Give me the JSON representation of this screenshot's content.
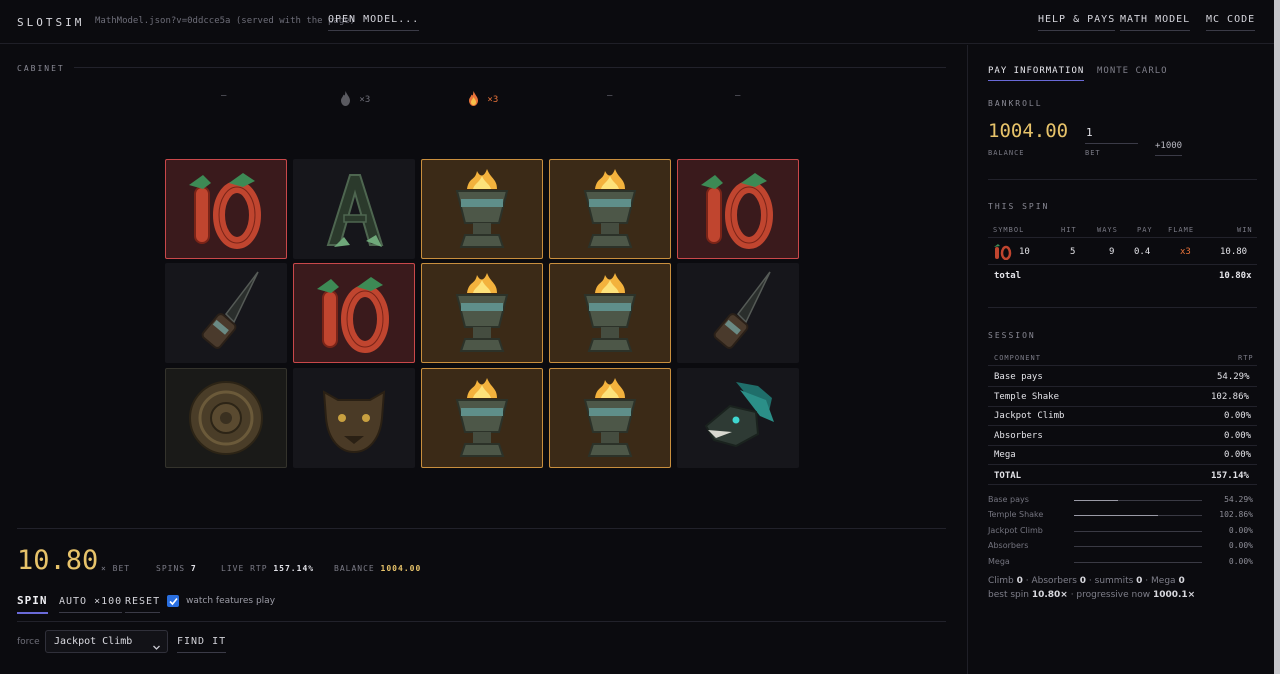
{
  "header": {
    "brand": "SLOTSIM",
    "model_path": "MathModel.json?v=0ddcce5a (served with the page)",
    "open_model": "OPEN MODEL...",
    "help_pays": "HELP & PAYS",
    "math_model": "MATH MODEL",
    "mc_code": "MC CODE"
  },
  "cabinet": {
    "label": "CABINET",
    "flames": [
      "–",
      "×3",
      "×3",
      "–",
      "–"
    ],
    "grid": [
      [
        "ten",
        "ace",
        "brazier",
        "brazier",
        "ten"
      ],
      [
        "dagger",
        "ten",
        "brazier",
        "brazier",
        "dagger"
      ],
      [
        "calendar",
        "jaguar",
        "brazier",
        "brazier",
        "serpent"
      ]
    ]
  },
  "result": {
    "win": "10.80",
    "win_unit": "× BET",
    "spins_label": "SPINS",
    "spins": "7",
    "rtp_label": "LIVE RTP",
    "rtp": "157.14%",
    "balance_label": "BALANCE",
    "balance": "1004.00"
  },
  "controls": {
    "spin": "SPIN",
    "auto": "AUTO ×100",
    "reset": "RESET",
    "watch_label": "watch features play",
    "watch_checked": true,
    "force_label": "force",
    "force_value": "Jackpot Climb",
    "find_it": "FIND IT"
  },
  "panel": {
    "tab_pay": "PAY INFORMATION",
    "tab_mc": "MONTE CARLO",
    "bankroll_label": "BANKROLL",
    "balance_value": "1004.00",
    "balance_caption": "BALANCE",
    "bet_value": "1",
    "bet_caption": "BET",
    "add_1000": "+1000",
    "this_spin_label": "THIS SPIN",
    "spin_headers": [
      "SYMBOL",
      "HIT",
      "WAYS",
      "PAY",
      "FLAME",
      "WIN"
    ],
    "spin_row": {
      "symbol": "10",
      "hit": "5",
      "ways": "9",
      "pay": "0.4",
      "flame": "x3",
      "win": "10.80"
    },
    "spin_total_label": "total",
    "spin_total": "10.80x",
    "session_label": "SESSION",
    "session_headers": [
      "COMPONENT",
      "RTP"
    ],
    "session_rows": [
      {
        "name": "Base pays",
        "rtp": "54.29%"
      },
      {
        "name": "Temple Shake",
        "rtp": "102.86%"
      },
      {
        "name": "Jackpot Climb",
        "rtp": "0.00%"
      },
      {
        "name": "Absorbers",
        "rtp": "0.00%"
      },
      {
        "name": "Mega",
        "rtp": "0.00%"
      }
    ],
    "session_total_label": "TOTAL",
    "session_total": "157.14%",
    "bars": [
      {
        "name": "Base pays",
        "value": "54.29%",
        "fraction": 0.3455
      },
      {
        "name": "Temple Shake",
        "value": "102.86%",
        "fraction": 0.6545
      },
      {
        "name": "Jackpot Climb",
        "value": "0.00%",
        "fraction": 0
      },
      {
        "name": "Absorbers",
        "value": "0.00%",
        "fraction": 0
      },
      {
        "name": "Mega",
        "value": "0.00%",
        "fraction": 0
      }
    ],
    "counts": {
      "climb_label": "Climb",
      "climb": "0",
      "absorbers_label": "Absorbers",
      "absorbers": "0",
      "summits_label": "summits",
      "summits": "0",
      "mega_label": "Mega",
      "mega": "0"
    },
    "best": {
      "best_label": "best spin",
      "best_value": "10.80×",
      "progressive_label": "progressive now",
      "progressive_value": "1000.1×"
    }
  },
  "colors": {
    "gold": "#e7c36a",
    "accent_blue": "#6a6ad8",
    "ten_border": "#c9484a",
    "brazier_border": "#c98f3e",
    "flame_orange": "#e8733a"
  }
}
